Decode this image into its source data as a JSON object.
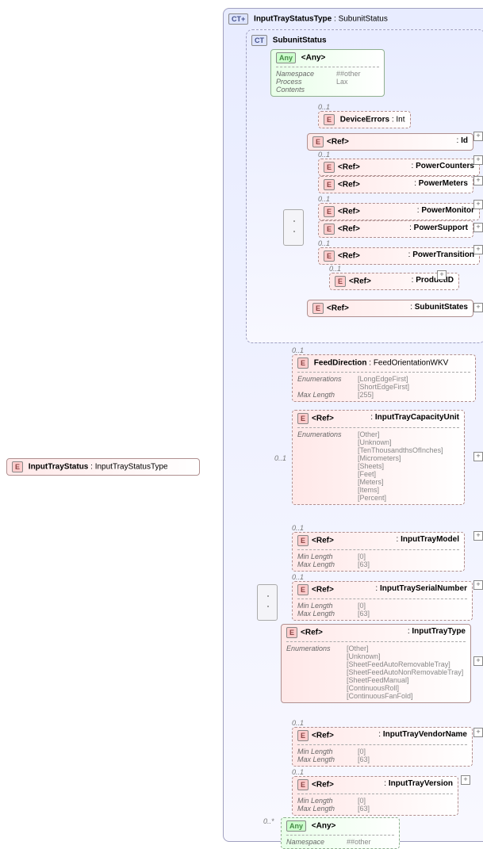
{
  "root": {
    "tag": "E",
    "name": "InputTrayStatus",
    "type": "InputTrayStatusType"
  },
  "ct_outer": {
    "tag": "CT",
    "name": "InputTrayStatusType",
    "base": "SubunitStatus",
    "plus": "+"
  },
  "ct_sub": {
    "tag": "CT",
    "name": "SubunitStatus"
  },
  "any1": {
    "tag": "Any",
    "label": "<Any>",
    "k1": "Namespace",
    "v1": "##other",
    "k2": "Process Contents",
    "v2": "Lax"
  },
  "sub_card_default": "0..1",
  "s1": {
    "name": "DeviceErrors",
    "type": "Int",
    "card": "0..1"
  },
  "s2": {
    "ref": "<Ref>",
    "type": "Id"
  },
  "s3": {
    "ref": "<Ref>",
    "type": "PowerCounters",
    "card": "0..1"
  },
  "s4": {
    "ref": "<Ref>",
    "type": "PowerMeters"
  },
  "s5": {
    "ref": "<Ref>",
    "type": "PowerMonitor",
    "card": "0..1"
  },
  "s6": {
    "ref": "<Ref>",
    "type": "PowerSupport"
  },
  "s7": {
    "ref": "<Ref>",
    "type": "PowerTransition",
    "card": "0..1"
  },
  "s8": {
    "ref": "<Ref>",
    "type": "ProductID",
    "card": "0..1"
  },
  "s9": {
    "ref": "<Ref>",
    "type": "SubunitStates"
  },
  "o1": {
    "tag": "E",
    "name": "FeedDirection",
    "type": "FeedOrientationWKV",
    "card": "0..1",
    "k1": "Enumerations",
    "v1a": "[LongEdgeFirst]",
    "v1b": "[ShortEdgeFirst]",
    "k2": "Max Length",
    "v2": "[255]"
  },
  "o2": {
    "tag": "E",
    "ref": "<Ref>",
    "type": "InputTrayCapacityUnit",
    "card": "0..1",
    "k1": "Enumerations",
    "enums": [
      "[Other]",
      "[Unknown]",
      "[TenThousandthsOfInches]",
      "[Micrometers]",
      "[Sheets]",
      "[Feet]",
      "[Meters]",
      "[Items]",
      "[Percent]"
    ]
  },
  "o3": {
    "tag": "E",
    "ref": "<Ref>",
    "type": "InputTrayModel",
    "card": "0..1",
    "k1": "Min Length",
    "v1": "[0]",
    "k2": "Max Length",
    "v2": "[63]"
  },
  "o4": {
    "tag": "E",
    "ref": "<Ref>",
    "type": "InputTraySerialNumber",
    "card": "0..1",
    "k1": "Min Length",
    "v1": "[0]",
    "k2": "Max Length",
    "v2": "[63]"
  },
  "o5": {
    "tag": "E",
    "ref": "<Ref>",
    "type": "InputTrayType",
    "k1": "Enumerations",
    "enums": [
      "[Other]",
      "[Unknown]",
      "[SheetFeedAutoRemovableTray]",
      "[SheetFeedAutoNonRemovableTray]",
      "[SheetFeedManual]",
      "[ContinuousRoll]",
      "[ContinuousFanFold]"
    ]
  },
  "o6": {
    "tag": "E",
    "ref": "<Ref>",
    "type": "InputTrayVendorName",
    "card": "0..1",
    "k1": "Min Length",
    "v1": "[0]",
    "k2": "Max Length",
    "v2": "[63]"
  },
  "o7": {
    "tag": "E",
    "ref": "<Ref>",
    "type": "InputTrayVersion",
    "card": "0..1",
    "k1": "Min Length",
    "v1": "[0]",
    "k2": "Max Length",
    "v2": "[63]"
  },
  "any2": {
    "tag": "Any",
    "label": "<Any>",
    "card": "0..*",
    "k1": "Namespace",
    "v1": "##other"
  },
  "plus": "+"
}
